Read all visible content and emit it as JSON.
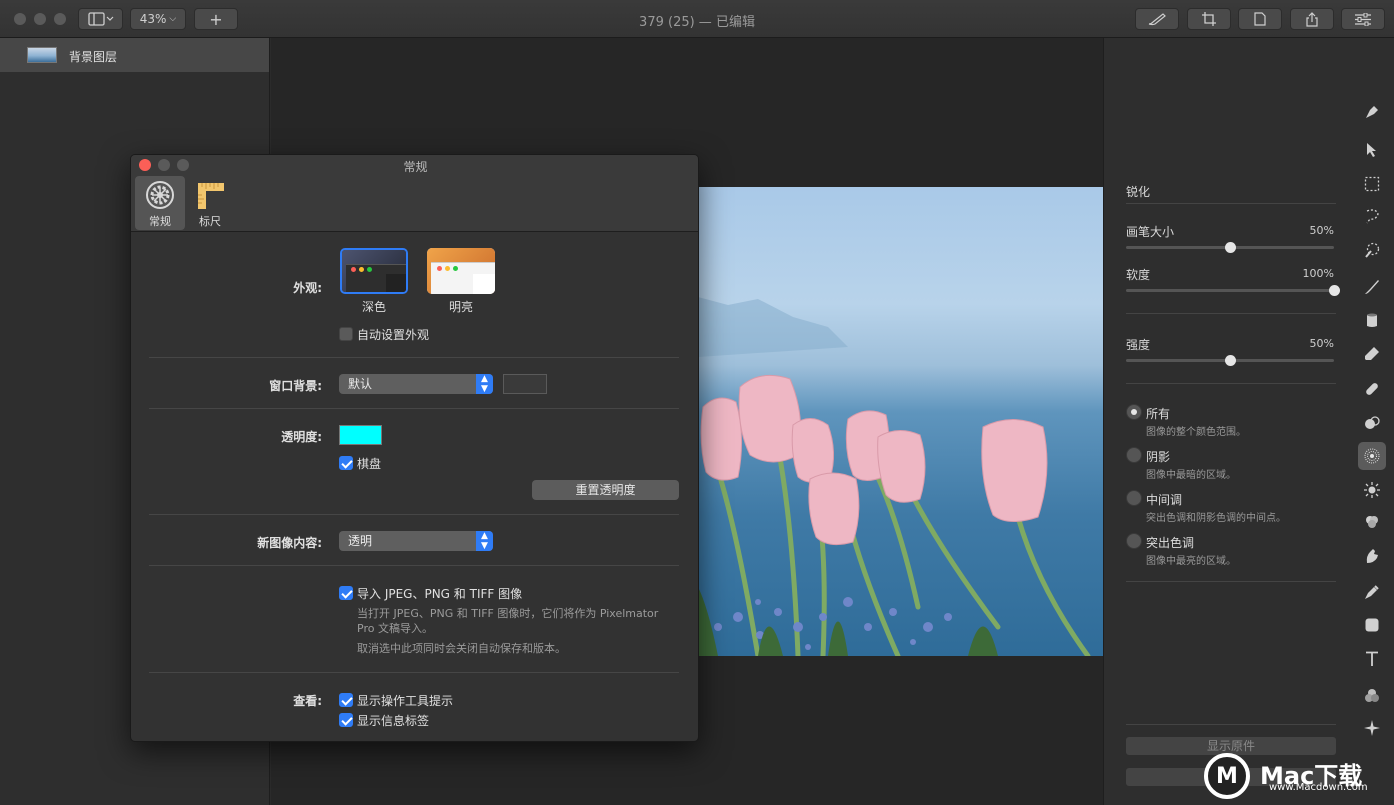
{
  "window": {
    "title": "379 (25) — 已编辑",
    "zoom": "43%",
    "add": "+"
  },
  "layers": {
    "items": [
      {
        "name": "背景图层"
      }
    ]
  },
  "panel": {
    "title": "锐化",
    "brush_size": {
      "label": "画笔大小",
      "value": "50%",
      "fraction": 0.5
    },
    "softness": {
      "label": "软度",
      "value": "100%",
      "fraction": 1.0
    },
    "strength": {
      "label": "强度",
      "value": "50%",
      "fraction": 0.5
    },
    "ranges": [
      {
        "label": "所有",
        "desc": "图像的整个颜色范围。",
        "selected": true
      },
      {
        "label": "阴影",
        "desc": "图像中最暗的区域。",
        "selected": false
      },
      {
        "label": "中间调",
        "desc": "突出色调和阴影色调的中间点。",
        "selected": false
      },
      {
        "label": "突出色调",
        "desc": "图像中最亮的区域。",
        "selected": false
      }
    ],
    "show_original": "显示原件"
  },
  "prefs": {
    "title": "常规",
    "tabs": [
      {
        "label": "常规",
        "icon": "gear-icon",
        "active": true
      },
      {
        "label": "标尺",
        "icon": "ruler-icon",
        "active": false
      }
    ],
    "appearance": {
      "label": "外观:",
      "dark": "深色",
      "light": "明亮",
      "auto_label": "自动设置外观",
      "auto_checked": false
    },
    "window_bg": {
      "label": "窗口背景:",
      "value": "默认"
    },
    "transparency": {
      "label": "透明度:",
      "color": "#00ffff",
      "checkerboard_label": "棋盘",
      "checkerboard_checked": true,
      "reset_label": "重置透明度"
    },
    "new_image": {
      "label": "新图像内容:",
      "value": "透明"
    },
    "import": {
      "label": "导入 JPEG、PNG 和 TIFF 图像",
      "checked": true,
      "desc1": "当打开 JPEG、PNG 和 TIFF 图像时，它们将作为 Pixelmator",
      "desc2": "Pro 文稿导入。",
      "desc3": "取消选中此项同时会关闭自动保存和版本。"
    },
    "view": {
      "label": "查看:",
      "tips_label": "显示操作工具提示",
      "tips_checked": true,
      "info_label": "显示信息标签",
      "info_checked": true
    }
  },
  "watermark": {
    "logo": "M",
    "text": "Mac下载",
    "url": "www.Macdown.com"
  },
  "colors": {
    "accent": "#2f7cf6",
    "close": "#fc5f57",
    "minimize": "#5a5a5a"
  }
}
